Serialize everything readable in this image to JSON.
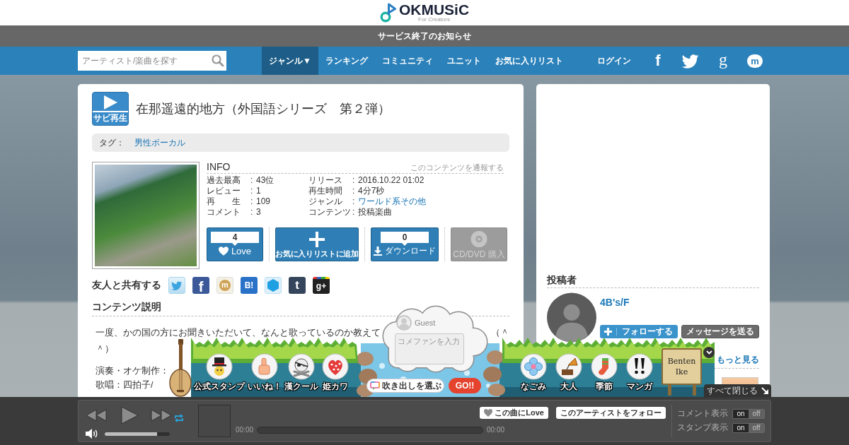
{
  "header": {
    "logo": {
      "wordmark": "OKMUSiC",
      "tagline": "For Creators"
    }
  },
  "notice": {
    "text": "サービス終了のお知らせ"
  },
  "nav": {
    "search": {
      "placeholder": "アーティスト/楽曲を探す"
    },
    "tabs": [
      {
        "label": "ジャンル▼",
        "selected": true
      },
      {
        "label": "ランキング",
        "selected": false
      },
      {
        "label": "コミュニティ",
        "selected": false
      },
      {
        "label": "ユニット",
        "selected": false
      },
      {
        "label": "お気に入りリスト",
        "selected": false
      }
    ],
    "login": "ログイン",
    "social": [
      {
        "kind": "facebook",
        "glyph": "f"
      },
      {
        "kind": "twitter"
      },
      {
        "kind": "google",
        "glyph": "g"
      },
      {
        "kind": "mixi",
        "glyph": "m"
      }
    ]
  },
  "song": {
    "preview_button": "サビ再生",
    "title": "在那遥遠的地方（外国語シリーズ　第２弾）",
    "tags": {
      "label": "タグ：",
      "items": [
        "男性ボーカル"
      ]
    },
    "info": {
      "heading": "INFO",
      "report_link": "このコンテンツを通報する",
      "columns": [
        [
          {
            "label": "過去最高",
            "sep": ":",
            "value": "43位",
            "link": false
          },
          {
            "label": "レビュー",
            "sep": ":",
            "value": "1",
            "link": false
          },
          {
            "label": "再　　生",
            "sep": ":",
            "value": "109",
            "link": false
          },
          {
            "label": "コメント",
            "sep": ":",
            "value": "3",
            "link": false
          }
        ],
        [
          {
            "label": "リリース",
            "sep": ":",
            "value": "2016.10.22 01:02",
            "link": false
          },
          {
            "label": "再生時間",
            "sep": ":",
            "value": "4分7秒",
            "link": false
          },
          {
            "label": "ジャンル",
            "sep": ":",
            "value": "ワールド系その他",
            "link": true
          },
          {
            "label": "コンテンツ",
            "sep": ":",
            "value": "投稿楽曲",
            "link": false
          }
        ]
      ]
    },
    "actions": [
      {
        "kind": "love",
        "count": "4",
        "label": "Love",
        "disabled": false
      },
      {
        "kind": "favorite",
        "label": "お気に入りリストに追加",
        "disabled": false
      },
      {
        "kind": "download",
        "count": "0",
        "label": "ダウンロード",
        "disabled": false
      },
      {
        "kind": "purchase",
        "label": "CD/DVD 購入",
        "disabled": true
      }
    ],
    "share": {
      "heading": "友人と共有する",
      "buttons": [
        {
          "kind": "twitter"
        },
        {
          "kind": "facebook",
          "glyph": "f"
        },
        {
          "kind": "mixi",
          "glyph": "m"
        },
        {
          "kind": "hatena",
          "glyph": "B!"
        },
        {
          "kind": "hexagon"
        },
        {
          "kind": "tumblr",
          "glyph": "t"
        },
        {
          "kind": "googleplus",
          "glyph": "g+"
        }
      ]
    },
    "description": {
      "heading": "コンテンツ説明",
      "paragraphs": [
        {
          "lines": [
            [
              "一度、かの国の方にお聞きいただいて、なんと歌っているのか教えて",
              "（＾"
            ],
            [
              "＾）"
            ]
          ]
        },
        {
          "lines": [
            [
              "演奏・オケ制作："
            ],
            [
              "歌唱：四拍子/"
            ]
          ]
        }
      ]
    }
  },
  "poster": {
    "heading": "投稿者",
    "name": "4B's/F",
    "follow_button": "フォローする",
    "message_button": "メッセージを送る",
    "more_link": "もっと見る"
  },
  "stamp_bar": {
    "stamps_left": [
      {
        "kind": "top-hat",
        "label": "公式スタンプ"
      },
      {
        "kind": "thumbs-up",
        "label": "いいね！"
      },
      {
        "kind": "skull",
        "label": "漢クール"
      },
      {
        "kind": "heart",
        "label": "姫カワ"
      }
    ],
    "comment": {
      "user": "Guest",
      "placeholder": "コメファンを入力"
    },
    "bubble_button": "吹き出しを選ぶ",
    "go_button": "GO!!",
    "stamps_right": [
      {
        "kind": "flower",
        "label": "なごみ"
      },
      {
        "kind": "gramophone",
        "label": "大人"
      },
      {
        "kind": "sock",
        "label": "季節"
      },
      {
        "kind": "exclamation",
        "label": "マンガ"
      }
    ],
    "sign": "Benten Ike",
    "close_all": "すべて閉じる"
  },
  "player": {
    "volume": {
      "level": 0.8
    },
    "start_time": "00:00",
    "end_time": "00:00",
    "love_button": "この曲にLove",
    "follow_button": "このアーティストをフォロー",
    "toggles": [
      {
        "label": "コメント表示",
        "on_label": "on",
        "off_label": "off",
        "on": true
      },
      {
        "label": "スタンプ表示",
        "on_label": "on",
        "off_label": "off",
        "on": true
      }
    ]
  }
}
